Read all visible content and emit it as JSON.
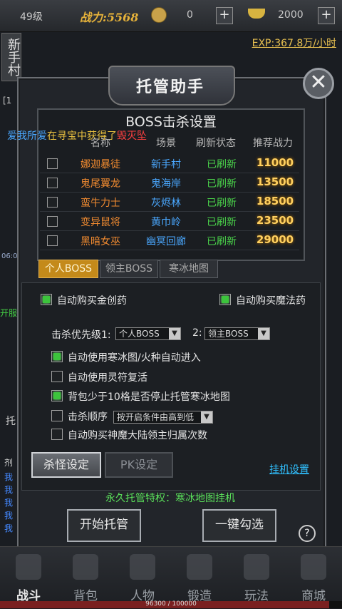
{
  "topbar": {
    "level": "49级",
    "power": "战力:5568",
    "gold": "0",
    "ingots": "2000",
    "plus": "+",
    "exp_rate": "EXP:367.8万/小时"
  },
  "side": {
    "village_label": "新手村",
    "fragments": [
      "[1",
      "爱我所爱",
      "06:0",
      "开服传",
      "托",
      "剂",
      "我",
      "我",
      "我",
      "我",
      "我"
    ]
  },
  "window": {
    "title": "托管助手",
    "close_label": "✕",
    "boss_section_title": "BOSS击杀设置",
    "chat_announcement": {
      "player": "爱我所爱",
      "middle": "在寻宝中获得了",
      "item": "毁灭坠"
    },
    "columns": [
      "名称",
      "场景",
      "刷新状态",
      "推荐战力"
    ],
    "bosses": [
      {
        "name": "娜迦暴徒",
        "scene": "新手村",
        "status": "已刷新",
        "power": "11000",
        "checked": false
      },
      {
        "name": "鬼尾翼龙",
        "scene": "鬼海岸",
        "status": "已刷新",
        "power": "13500",
        "checked": false
      },
      {
        "name": "蛮牛力士",
        "scene": "灰烬林",
        "status": "已刷新",
        "power": "18500",
        "checked": false
      },
      {
        "name": "变异鼠将",
        "scene": "黄巾岭",
        "status": "已刷新",
        "power": "23500",
        "checked": false
      },
      {
        "name": "黑暗女巫",
        "scene": "幽冥回廊",
        "status": "已刷新",
        "power": "29000",
        "checked": false
      }
    ],
    "tabs": [
      {
        "label": "个人BOSS",
        "active": true
      },
      {
        "label": "领主BOSS",
        "active": false
      },
      {
        "label": "寒冰地图",
        "active": false
      }
    ],
    "settings": {
      "auto_hp_potion": {
        "label": "自动购买金创药",
        "checked": true
      },
      "auto_mp_potion": {
        "label": "自动购买魔法药",
        "checked": true
      },
      "priority1_label": "击杀优先级1:",
      "priority1_value": "个人BOSS",
      "priority2_label": "2:",
      "priority2_value": "领主BOSS",
      "options": [
        {
          "label": "自动使用寒冰图/火种自动进入",
          "checked": true
        },
        {
          "label": "自动使用灵符复活",
          "checked": false
        },
        {
          "label": "背包少于10格是否停止托管寒冰地图",
          "checked": true
        },
        {
          "label": "击杀顺序",
          "checked": false
        },
        {
          "label": "自动购买神魔大陆领主归属次数",
          "checked": false
        }
      ],
      "kill_order_value": "按开启条件由高到低"
    },
    "buttons": {
      "kill_settings": "杀怪设定",
      "pk_settings": "PK设定",
      "hang_settings": "挂机设置",
      "start": "开始托管",
      "one_click": "一键勾选",
      "help": "?"
    },
    "privilege_text": "永久托管特权：寒冰地图挂机"
  },
  "bottom_nav": {
    "items": [
      "战斗",
      "背包",
      "人物",
      "锻造",
      "玩法",
      "商城"
    ],
    "hp_text": "96300 / 100000",
    "hp_fraction": 0.963
  },
  "colors": {
    "accent_gold": "#c48a1a",
    "boss_name": "#f08a30",
    "scene": "#4aa8ff",
    "status_green": "#4ad24a",
    "power_gold": "#ffd060"
  }
}
